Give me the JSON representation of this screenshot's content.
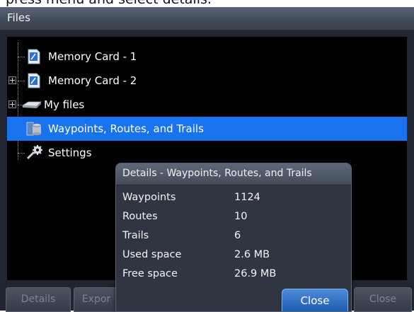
{
  "caption": "press menu and select details.",
  "window": {
    "title": "Files"
  },
  "tree": {
    "items": [
      {
        "label": "Memory Card - 1",
        "icon": "memory-card-icon",
        "expandable": false,
        "selected": false
      },
      {
        "label": "Memory Card - 2",
        "icon": "memory-card-icon",
        "expandable": true,
        "selected": false
      },
      {
        "label": "My files",
        "icon": "drive-icon",
        "expandable": true,
        "selected": false
      },
      {
        "label": "Waypoints, Routes, and Trails",
        "icon": "database-icon",
        "expandable": false,
        "selected": true
      },
      {
        "label": "Settings",
        "icon": "settings-gear-icon",
        "expandable": false,
        "selected": false
      }
    ]
  },
  "dialog": {
    "title": "Details - Waypoints, Routes, and Trails",
    "rows": [
      {
        "label": "Waypoints",
        "value": "1124"
      },
      {
        "label": "Routes",
        "value": "10"
      },
      {
        "label": "Trails",
        "value": "6"
      },
      {
        "label": "Used space",
        "value": "2.6 MB"
      },
      {
        "label": "Free space",
        "value": "26.9 MB"
      }
    ],
    "close_label": "Close"
  },
  "bottom_tabs": {
    "details": "Details",
    "export": "Expor",
    "close": "Close"
  },
  "colors": {
    "selection": "#1a73ee",
    "background": "#000000",
    "button_primary": "#1b56ad"
  }
}
